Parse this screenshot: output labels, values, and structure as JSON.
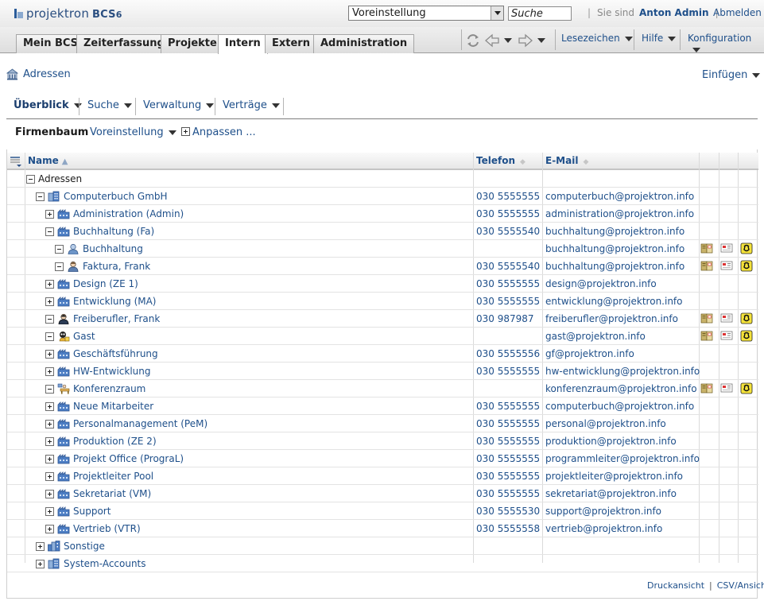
{
  "app": {
    "logo_name": "projektron",
    "logo_product": "BCS",
    "logo_version": "6"
  },
  "header": {
    "preset_value": "Voreinstellung",
    "search_value": "Suche",
    "signed_in_label": "Sie sind",
    "user_name": "Anton Admin",
    "logout": "Abmelden"
  },
  "tabs": [
    {
      "label": "Mein BCS"
    },
    {
      "label": "Zeiterfassung"
    },
    {
      "label": "Projekte"
    },
    {
      "label": "Intern",
      "active": true
    },
    {
      "label": "Extern"
    },
    {
      "label": "Administration"
    }
  ],
  "menus": {
    "bookmarks": "Lesezeichen",
    "help": "Hilfe",
    "config": "Konfiguration"
  },
  "page": {
    "title": "Adressen",
    "insert": "Einfügen"
  },
  "subnav": [
    "Überblick",
    "Suche",
    "Verwaltung",
    "Verträge"
  ],
  "toolbar": {
    "view": "Firmenbaum",
    "preset": "Voreinstellung",
    "customize": "Anpassen ..."
  },
  "table": {
    "columns": {
      "name": "Name",
      "phone": "Telefon",
      "email": "E-Mail"
    },
    "rows": [
      {
        "name": "Adressen",
        "phone": "",
        "email": ""
      },
      {
        "name": "Computerbuch GmbH",
        "phone": "030 5555555",
        "email": "computerbuch@projektron.info"
      },
      {
        "name": "Administration (Admin)",
        "phone": "030 5555555",
        "email": "administration@projektron.info"
      },
      {
        "name": "Buchhaltung (Fa)",
        "phone": "030 5555540",
        "email": "buchhaltung@projektron.info"
      },
      {
        "name": "Buchhaltung",
        "phone": "",
        "email": "buchhaltung@projektron.info"
      },
      {
        "name": "Faktura, Frank",
        "phone": "030 5555540",
        "email": "buchhaltung@projektron.info"
      },
      {
        "name": "Design (ZE 1)",
        "phone": "030 5555555",
        "email": "design@projektron.info"
      },
      {
        "name": "Entwicklung (MA)",
        "phone": "030 5555555",
        "email": "entwicklung@projektron.info"
      },
      {
        "name": "Freiberufler, Frank",
        "phone": "030 987987",
        "email": "freiberufler@projektron.info"
      },
      {
        "name": "Gast",
        "phone": "",
        "email": "gast@projektron.info"
      },
      {
        "name": "Geschäftsführung",
        "phone": "030 5555556",
        "email": "gf@projektron.info"
      },
      {
        "name": "HW-Entwicklung",
        "phone": "030 5555555",
        "email": "hw-entwicklung@projektron.info"
      },
      {
        "name": "Konferenzraum",
        "phone": "",
        "email": "konferenzraum@projektron.info"
      },
      {
        "name": "Neue Mitarbeiter",
        "phone": "030 5555555",
        "email": "computerbuch@projektron.info"
      },
      {
        "name": "Personalmanagement (PeM)",
        "phone": "030 5555555",
        "email": "personal@projektron.info"
      },
      {
        "name": "Produktion (ZE 2)",
        "phone": "030 5555555",
        "email": "produktion@projektron.info"
      },
      {
        "name": "Projekt Office (PrograL)",
        "phone": "030 5555555",
        "email": "programmleiter@projektron.info"
      },
      {
        "name": "Projektleiter Pool",
        "phone": "030 5555555",
        "email": "projektleiter@projektron.info"
      },
      {
        "name": "Sekretariat (VM)",
        "phone": "030 5555555",
        "email": "sekretariat@projektron.info"
      },
      {
        "name": "Support",
        "phone": "030 5555530",
        "email": "support@projektron.info"
      },
      {
        "name": "Vertrieb (VTR)",
        "phone": "030 5555558",
        "email": "vertrieb@projektron.info"
      },
      {
        "name": "Sonstige",
        "phone": "",
        "email": ""
      },
      {
        "name": "System-Accounts",
        "phone": "",
        "email": ""
      }
    ]
  },
  "footer": {
    "print": "Druckansicht",
    "csv": "CSV/Ansicht"
  }
}
